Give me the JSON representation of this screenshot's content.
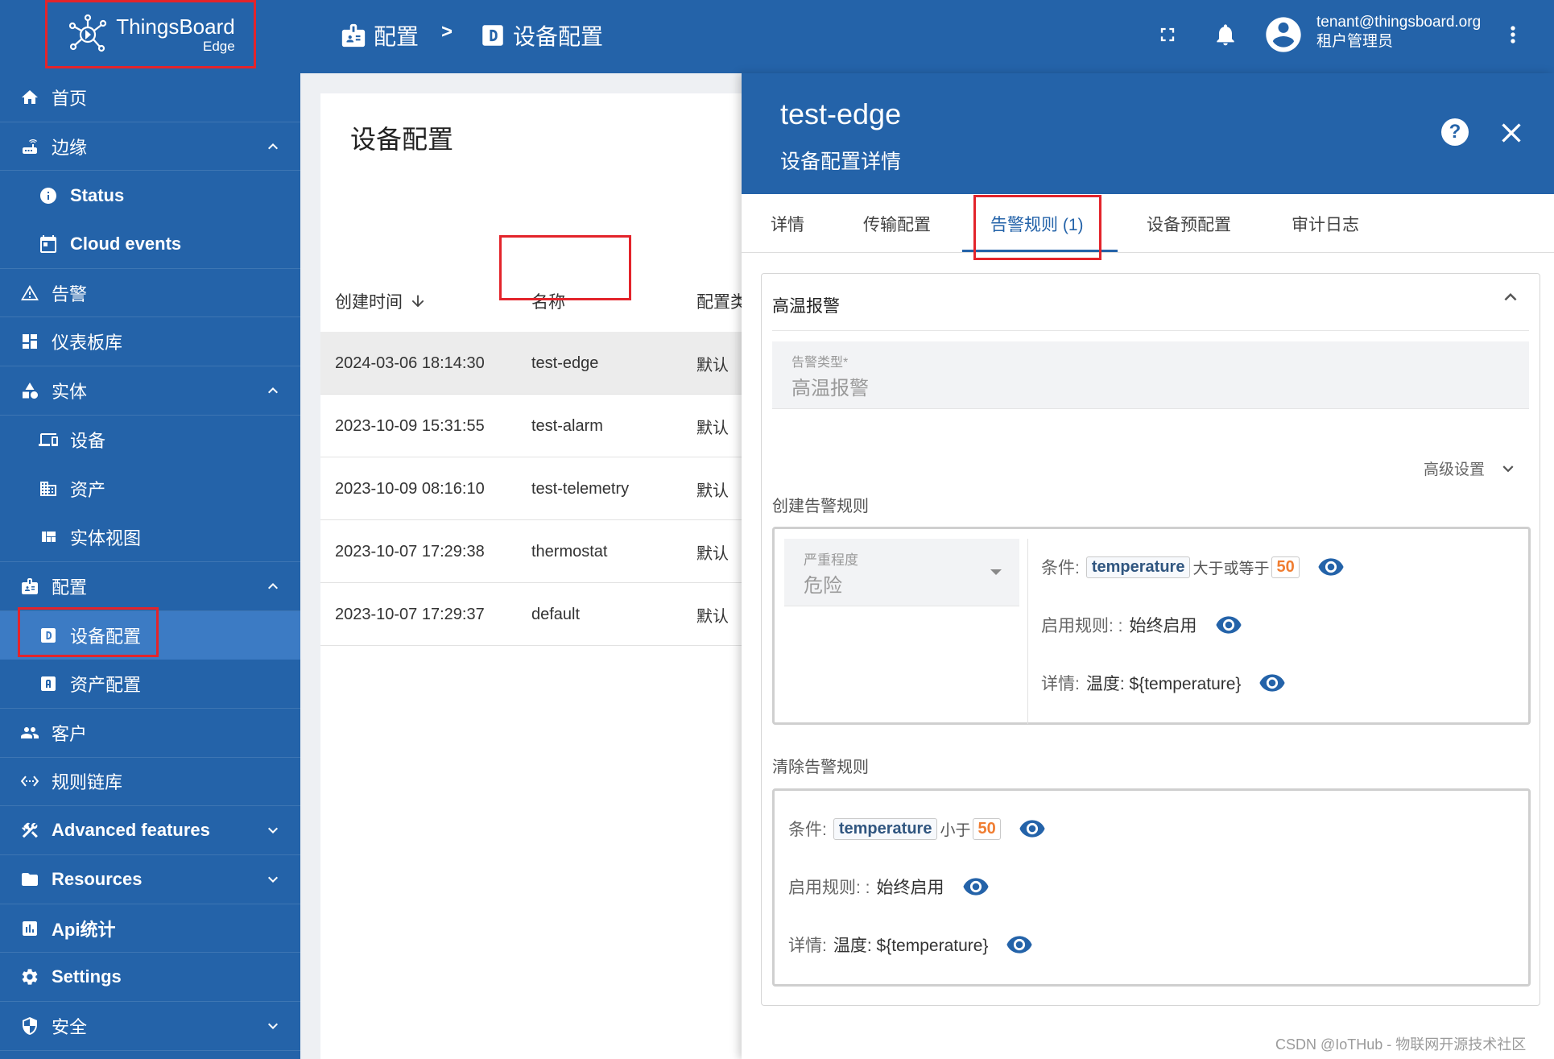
{
  "brand": {
    "name": "ThingsBoard",
    "sub": "Edge"
  },
  "sidebar": {
    "items": [
      {
        "label": "首页",
        "icon": "home-icon",
        "level": 0
      },
      {
        "label": "边缘",
        "icon": "router-icon",
        "level": 0,
        "chevron": "up"
      },
      {
        "label": "Status",
        "icon": "info-icon",
        "level": 1,
        "bold": true
      },
      {
        "label": "Cloud events",
        "icon": "calendar-icon",
        "level": 1,
        "bold": true,
        "last": true
      },
      {
        "label": "告警",
        "icon": "warning-icon",
        "level": 0
      },
      {
        "label": "仪表板库",
        "icon": "dashboard-icon",
        "level": 0
      },
      {
        "label": "实体",
        "icon": "category-icon",
        "level": 0,
        "chevron": "up"
      },
      {
        "label": "设备",
        "icon": "devices-icon",
        "level": 1
      },
      {
        "label": "资产",
        "icon": "domain-icon",
        "level": 1
      },
      {
        "label": "实体视图",
        "icon": "view-quilt-icon",
        "level": 1,
        "last": true
      },
      {
        "label": "配置",
        "icon": "badge-icon",
        "level": 0,
        "chevron": "up"
      },
      {
        "label": "设备配置",
        "icon": "device-profile-icon",
        "level": 1,
        "active": true
      },
      {
        "label": "资产配置",
        "icon": "asset-profile-icon",
        "level": 1,
        "last": true
      },
      {
        "label": "客户",
        "icon": "group-icon",
        "level": 0
      },
      {
        "label": "规则链库",
        "icon": "settings-ethernet-icon",
        "level": 0
      },
      {
        "label": "Advanced features",
        "icon": "construction-icon",
        "level": 0,
        "bold": true,
        "chevron": "down"
      },
      {
        "label": "Resources",
        "icon": "folder-icon",
        "level": 0,
        "bold": true,
        "chevron": "down"
      },
      {
        "label": "Api统计",
        "icon": "insert-chart-icon",
        "level": 0,
        "bold": true
      },
      {
        "label": "Settings",
        "icon": "gear-icon",
        "level": 0,
        "bold": true
      },
      {
        "label": "安全",
        "icon": "security-icon",
        "level": 0,
        "chevron": "down"
      }
    ]
  },
  "topbar": {
    "crumb1": "配置",
    "crumb_sep": ">",
    "crumb2": "设备配置",
    "user_email": "tenant@thingsboard.org",
    "user_role": "租户管理员"
  },
  "list": {
    "title": "设备配置",
    "columns": [
      "创建时间",
      "名称",
      "配置类"
    ],
    "rows": [
      {
        "created": "2024-03-06 18:14:30",
        "name": "test-edge",
        "type": "默认",
        "selected": true
      },
      {
        "created": "2023-10-09 15:31:55",
        "name": "test-alarm",
        "type": "默认"
      },
      {
        "created": "2023-10-09 08:16:10",
        "name": "test-telemetry",
        "type": "默认"
      },
      {
        "created": "2023-10-07 17:29:38",
        "name": "thermostat",
        "type": "默认"
      },
      {
        "created": "2023-10-07 17:29:37",
        "name": "default",
        "type": "默认"
      }
    ]
  },
  "details": {
    "title": "test-edge",
    "subtitle": "设备配置详情",
    "help": "?",
    "tabs": [
      "详情",
      "传输配置",
      "告警规则 (1)",
      "设备预配置",
      "审计日志"
    ],
    "active_tab": 2,
    "alarm": {
      "title": "高温报警",
      "type_label": "告警类型*",
      "type_value": "高温报警",
      "advanced": "高级设置",
      "create_title": "创建告警规则",
      "severity_label": "严重程度",
      "severity_value": "危险",
      "create_condition_label": "条件:",
      "create_key": "temperature",
      "create_op": "大于或等于",
      "create_val": "50",
      "schedule_label": "启用规则: :",
      "schedule_value": "始终启用",
      "details_label": "详情:",
      "details_value": "温度: ${temperature}",
      "clear_title": "清除告警规则",
      "clear_condition_label": "条件:",
      "clear_key": "temperature",
      "clear_op": "小于",
      "clear_val": "50",
      "clear_schedule_label": "启用规则: :",
      "clear_schedule_value": "始终启用",
      "clear_details_label": "详情:",
      "clear_details_value": "温度: ${temperature}"
    }
  },
  "watermark": "CSDN @IoTHub - 物联网开源技术社区",
  "colors": {
    "primary": "#2463a9",
    "active_nav": "#3c7bc4",
    "highlight": "#e3242b",
    "value_orange": "#f07d31"
  }
}
